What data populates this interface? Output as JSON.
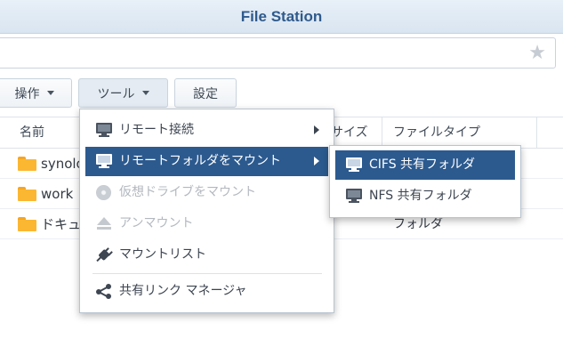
{
  "window": {
    "title": "File Station"
  },
  "toolbar": {
    "action_label": "操作",
    "tools_label": "ツール",
    "settings_label": "設定"
  },
  "grid": {
    "columns": [
      "名前",
      "サイズ",
      "ファイルタイプ"
    ],
    "rows": [
      {
        "name": "synology",
        "type": ""
      },
      {
        "name": "work",
        "type": ""
      },
      {
        "name": "ドキュメント",
        "type": "フォルダ"
      }
    ]
  },
  "tools_menu": {
    "items": [
      {
        "label": "リモート接続",
        "icon": "monitor-icon",
        "submenu": true,
        "state": "normal"
      },
      {
        "label": "リモートフォルダをマウント",
        "icon": "monitor-icon",
        "submenu": true,
        "state": "selected"
      },
      {
        "label": "仮想ドライブをマウント",
        "icon": "disc-icon",
        "submenu": false,
        "state": "disabled"
      },
      {
        "label": "アンマウント",
        "icon": "eject-icon",
        "submenu": false,
        "state": "disabled"
      },
      {
        "label": "マウントリスト",
        "icon": "plug-icon",
        "submenu": false,
        "state": "normal"
      },
      {
        "label": "共有リンク マネージャ",
        "icon": "share-icon",
        "submenu": false,
        "state": "normal"
      }
    ]
  },
  "mount_submenu": {
    "items": [
      {
        "label": "CIFS 共有フォルダ",
        "icon": "monitor-icon",
        "state": "selected"
      },
      {
        "label": "NFS 共有フォルダ",
        "icon": "monitor-icon",
        "state": "normal"
      }
    ]
  },
  "colors": {
    "accent": "#2c5a8f",
    "title": "#2f5a8c",
    "folder": "#fbb731"
  }
}
